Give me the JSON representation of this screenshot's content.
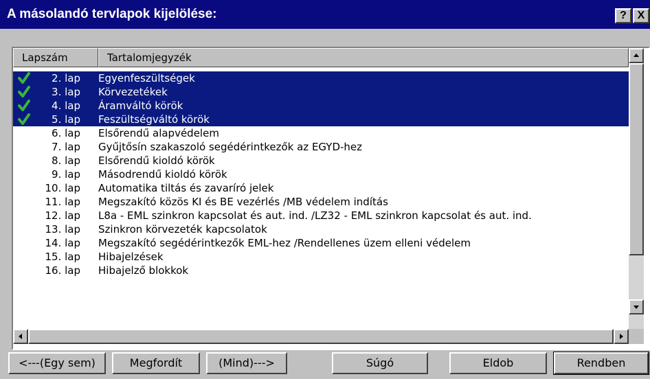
{
  "dialog": {
    "title": "A másolandó tervlapok kijelölése:",
    "help_btn": "?",
    "close_btn": "X"
  },
  "list": {
    "columns": [
      "Lapszám",
      "Tartalomjegyzék"
    ],
    "rows": [
      {
        "num": "2. lap",
        "text": "Egyenfeszültségek",
        "selected": true
      },
      {
        "num": "3. lap",
        "text": "Körvezetékek",
        "selected": true
      },
      {
        "num": "4. lap",
        "text": "Áramváltó körök",
        "selected": true
      },
      {
        "num": "5. lap",
        "text": "Feszültségváltó körök",
        "selected": true
      },
      {
        "num": "6. lap",
        "text": "Elsőrendű alapvédelem",
        "selected": false
      },
      {
        "num": "7. lap",
        "text": "Gyűjtősín szakaszoló segédérintkezők az EGYD-hez",
        "selected": false
      },
      {
        "num": "8. lap",
        "text": "Elsőrendű kioldó körök",
        "selected": false
      },
      {
        "num": "9. lap",
        "text": "Másodrendű kioldó körök",
        "selected": false
      },
      {
        "num": "10. lap",
        "text": "Automatika tiltás és zavaríró jelek",
        "selected": false
      },
      {
        "num": "11. lap",
        "text": "Megszakító közös KI és BE vezérlés   /MB védelem indítás",
        "selected": false
      },
      {
        "num": "12. lap",
        "text": "L8a - EML szinkron kapcsolat és aut. ind.   /LZ32 - EML szinkron kapcsolat és aut. ind.",
        "selected": false
      },
      {
        "num": "13. lap",
        "text": "Szinkron körvezeték kapcsolatok",
        "selected": false
      },
      {
        "num": "14. lap",
        "text": "Megszakító segédérintkezők EML-hez   /Rendellenes üzem elleni védelem",
        "selected": false
      },
      {
        "num": "15. lap",
        "text": "Hibajelzések",
        "selected": false
      },
      {
        "num": "16. lap",
        "text": "Hibajelző blokkok",
        "selected": false
      }
    ]
  },
  "buttons": {
    "none": "<---(Egy sem)",
    "invert": "Megfordít",
    "all": "(Mind)--->",
    "help": "Súgó",
    "discard": "Eldob",
    "ok": "Rendben"
  },
  "colors": {
    "title_bg": "#0a0a80",
    "selection_bg": "#0a1a80",
    "check_mark": "#3cb43c"
  }
}
